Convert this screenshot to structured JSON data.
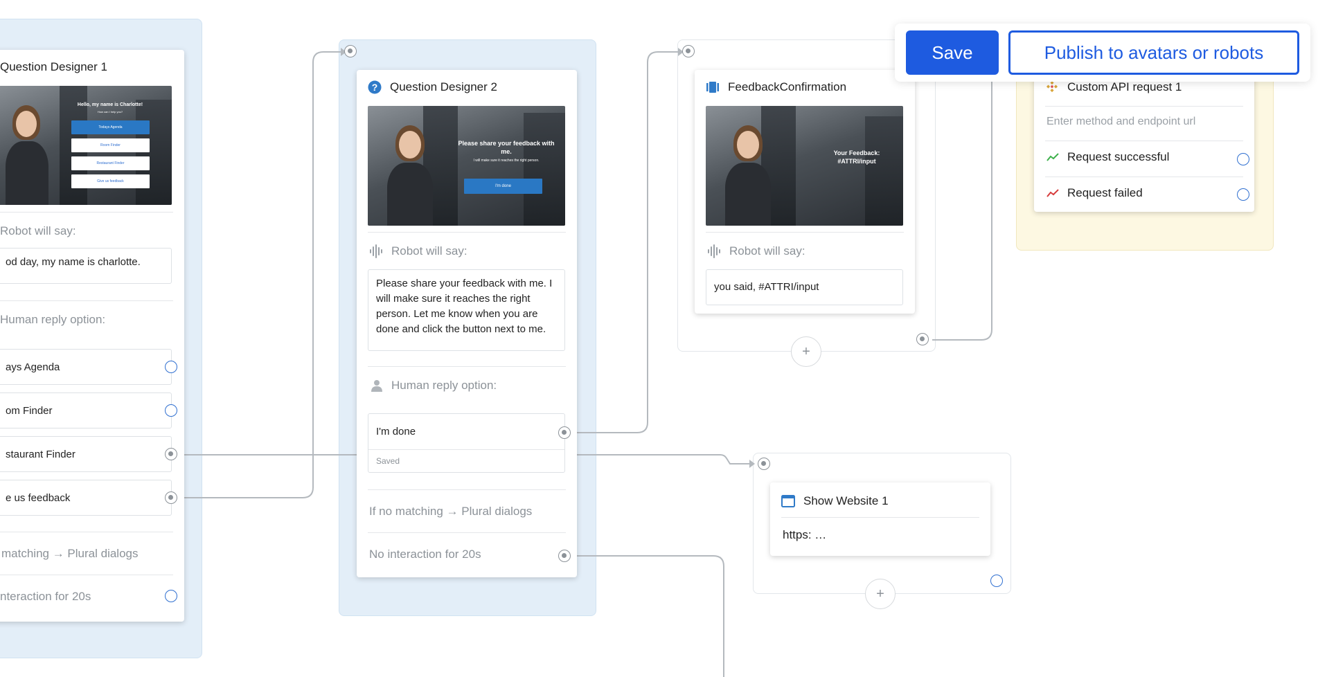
{
  "toolbar": {
    "save_label": "Save",
    "publish_label": "Publish to avatars or robots",
    "accent_color": "#1e5be0"
  },
  "node1": {
    "title": "Question Designer 1",
    "thumb_heading": "Hello, my name is Charlotte!",
    "thumb_sub": "How can I help you?",
    "thumb_buttons": [
      "Todays Agenda",
      "Room Finder",
      "Restaurant Finder",
      "Give us feedback"
    ],
    "robot_label": "Robot will say:",
    "robot_text": "od day, my name is charlotte.",
    "human_label": "Human reply option:",
    "options": [
      "ays Agenda",
      "om Finder",
      "staurant Finder",
      "e us feedback"
    ],
    "no_match": "matching → Plural dialogs",
    "no_interaction": "nteraction for 20s"
  },
  "node2": {
    "title": "Question Designer 2",
    "thumb_heading": "Please share your feedback with me.",
    "thumb_sub": "I will make sure it reaches the right person.",
    "thumb_button": "I'm done",
    "robot_label": "Robot will say:",
    "robot_text": "Please share your feedback with me. I will make sure it reaches the right person. Let me know when you are done and click the button next to me.",
    "human_label": "Human reply option:",
    "option": "I'm done",
    "option_status": "Saved",
    "no_match": "If no matching → Plural dialogs",
    "no_interaction": "No interaction for 20s"
  },
  "node3": {
    "title": "FeedbackConfirmation",
    "thumb_heading": "Your Feedback: #ATTRI/input",
    "robot_label": "Robot will say:",
    "robot_text": "you said, #ATTRI/input"
  },
  "node4": {
    "title": "Custom API request 1",
    "placeholder": "Enter method and endpoint url",
    "success": "Request successful",
    "failed": "Request failed"
  },
  "node5": {
    "title": "Show Website 1",
    "url": "https: …"
  },
  "icons": {
    "add": "+"
  }
}
